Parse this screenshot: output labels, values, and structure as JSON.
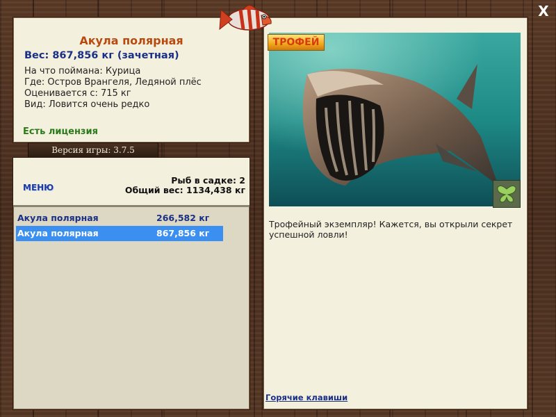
{
  "info": {
    "fish_name": "Акула полярная",
    "weight": "Вес: 867,856 кг (зачетная)",
    "bait": "На что поймана: Курица",
    "location": "Где: Остров Врангеля, Ледяной плёс",
    "valued_from": "Оценивается с: 715 кг",
    "kind": "Вид: Ловится очень редко",
    "license": "Есть лицензия"
  },
  "version": "Версия игры: 3.7.5",
  "list": {
    "menu_label": "МЕНЮ",
    "catch_count": "Рыб в садке: 2",
    "total_weight": "Общий вес: 1134,438 кг",
    "rows": [
      {
        "name": "Акула полярная",
        "weight": "266,582 кг",
        "selected": false
      },
      {
        "name": "Акула полярная",
        "weight": "867,856 кг",
        "selected": true
      }
    ]
  },
  "detail": {
    "trophy_label": "ТРОФЕЙ",
    "description": "Трофейный экземпляр! Кажется, вы открыли секрет успешной ловли!",
    "hotkeys_link": "Горячие клавиши"
  },
  "close_label": "X",
  "colors": {
    "title": "#b84a10",
    "weight": "#1a2f86",
    "license": "#2a7a1a",
    "selected_row": "#3a8ff0",
    "panel": "#f4f0de"
  },
  "icons": [
    "fish-icon",
    "close-icon",
    "butterfly-icon"
  ]
}
